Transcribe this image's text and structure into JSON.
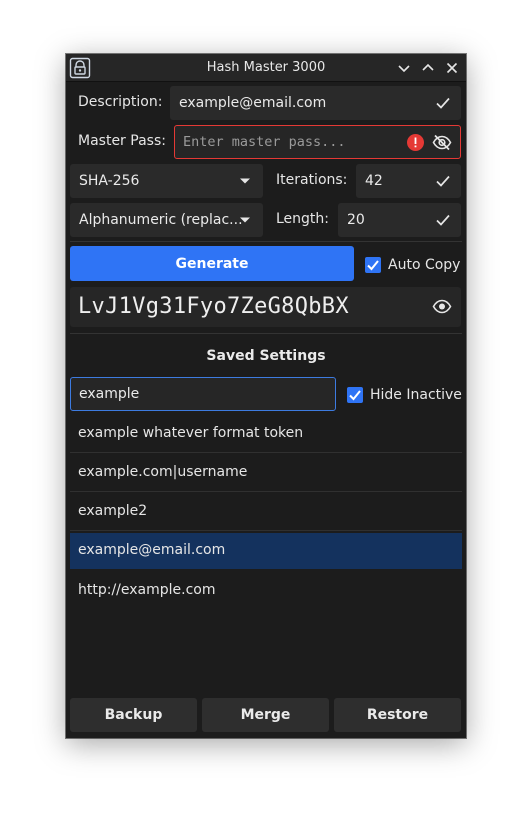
{
  "window": {
    "title": "Hash Master 3000"
  },
  "form": {
    "description_label": "Description:",
    "description_value": "example@email.com",
    "master_pass_label": "Master Pass:",
    "master_pass_placeholder": "Enter master pass...",
    "hash_algorithm": "SHA-256",
    "iterations_label": "Iterations:",
    "iterations_value": "42",
    "format": "Alphanumeric (replac...",
    "length_label": "Length:",
    "length_value": "20"
  },
  "actions": {
    "generate_label": "Generate",
    "auto_copy_label": "Auto Copy",
    "auto_copy_checked": true
  },
  "output": {
    "password": "LvJ1Vg31Fyo7ZeG8QbBX"
  },
  "saved": {
    "title": "Saved Settings",
    "search_value": "example",
    "hide_inactive_label": "Hide Inactive",
    "hide_inactive_checked": true,
    "items": [
      {
        "label": "example whatever format token"
      },
      {
        "label": "example.com|username"
      },
      {
        "label": "example2"
      },
      {
        "label": "example@email.com",
        "selected": true
      },
      {
        "label": "http://example.com"
      }
    ]
  },
  "bottom": {
    "backup_label": "Backup",
    "merge_label": "Merge",
    "restore_label": "Restore"
  },
  "colors": {
    "accent": "#2f74f5",
    "error": "#e53935",
    "selected_row": "#14325e",
    "background": "#1c1c1c"
  }
}
